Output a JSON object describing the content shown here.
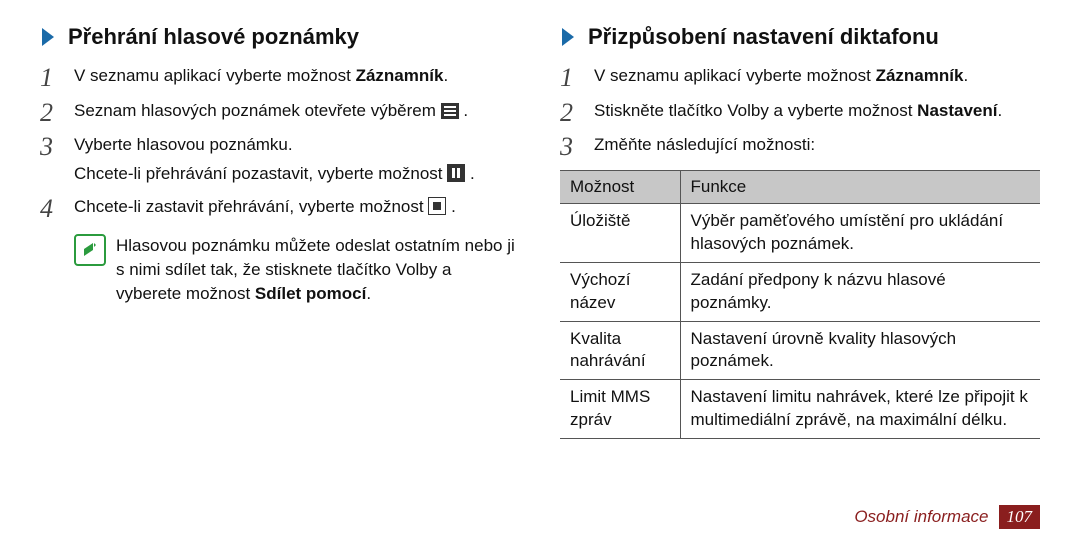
{
  "left": {
    "title": "Přehrání hlasové poznámky",
    "steps": {
      "s1_pre": "V seznamu aplikací vyberte možnost ",
      "s1_bold": "Záznamník",
      "s1_post": ".",
      "s2_pre": "Seznam hlasových poznámek otevřete výběrem ",
      "s2_post": ".",
      "s3_line1": "Vyberte hlasovou poznámku.",
      "s3_line2_pre": "Chcete-li přehrávání pozastavit, vyberte možnost ",
      "s3_line2_post": ".",
      "s4_pre": "Chcete-li zastavit přehrávání, vyberte možnost ",
      "s4_post": "."
    },
    "note_pre": "Hlasovou poznámku můžete odeslat ostatním nebo ji s nimi sdílet tak, že stisknete tlačítko Volby a vyberete možnost ",
    "note_bold": "Sdílet pomocí",
    "note_post": "."
  },
  "right": {
    "title": "Přizpůsobení nastavení diktafonu",
    "steps": {
      "s1_pre": "V seznamu aplikací vyberte možnost ",
      "s1_bold": "Záznamník",
      "s1_post": ".",
      "s2_pre": "Stiskněte tlačítko Volby a vyberte možnost ",
      "s2_bold": "Nastavení",
      "s2_post": ".",
      "s3": "Změňte následující možnosti:"
    },
    "table": {
      "head_option": "Možnost",
      "head_function": "Funkce",
      "rows": [
        {
          "opt": "Úložiště",
          "func": "Výběr paměťového umístění pro ukládání hlasových poznámek."
        },
        {
          "opt": "Výchozí název",
          "func": "Zadání předpony k názvu hlasové poznámky."
        },
        {
          "opt": "Kvalita nahrávání",
          "func": "Nastavení úrovně kvality hlasových poznámek."
        },
        {
          "opt": "Limit MMS zpráv",
          "func": "Nastavení limitu nahrávek, které lze připojit k multimediální zprávě, na maximální délku."
        }
      ]
    }
  },
  "footer": {
    "category": "Osobní informace",
    "page": "107"
  },
  "nums": {
    "n1": "1",
    "n2": "2",
    "n3": "3",
    "n4": "4"
  }
}
